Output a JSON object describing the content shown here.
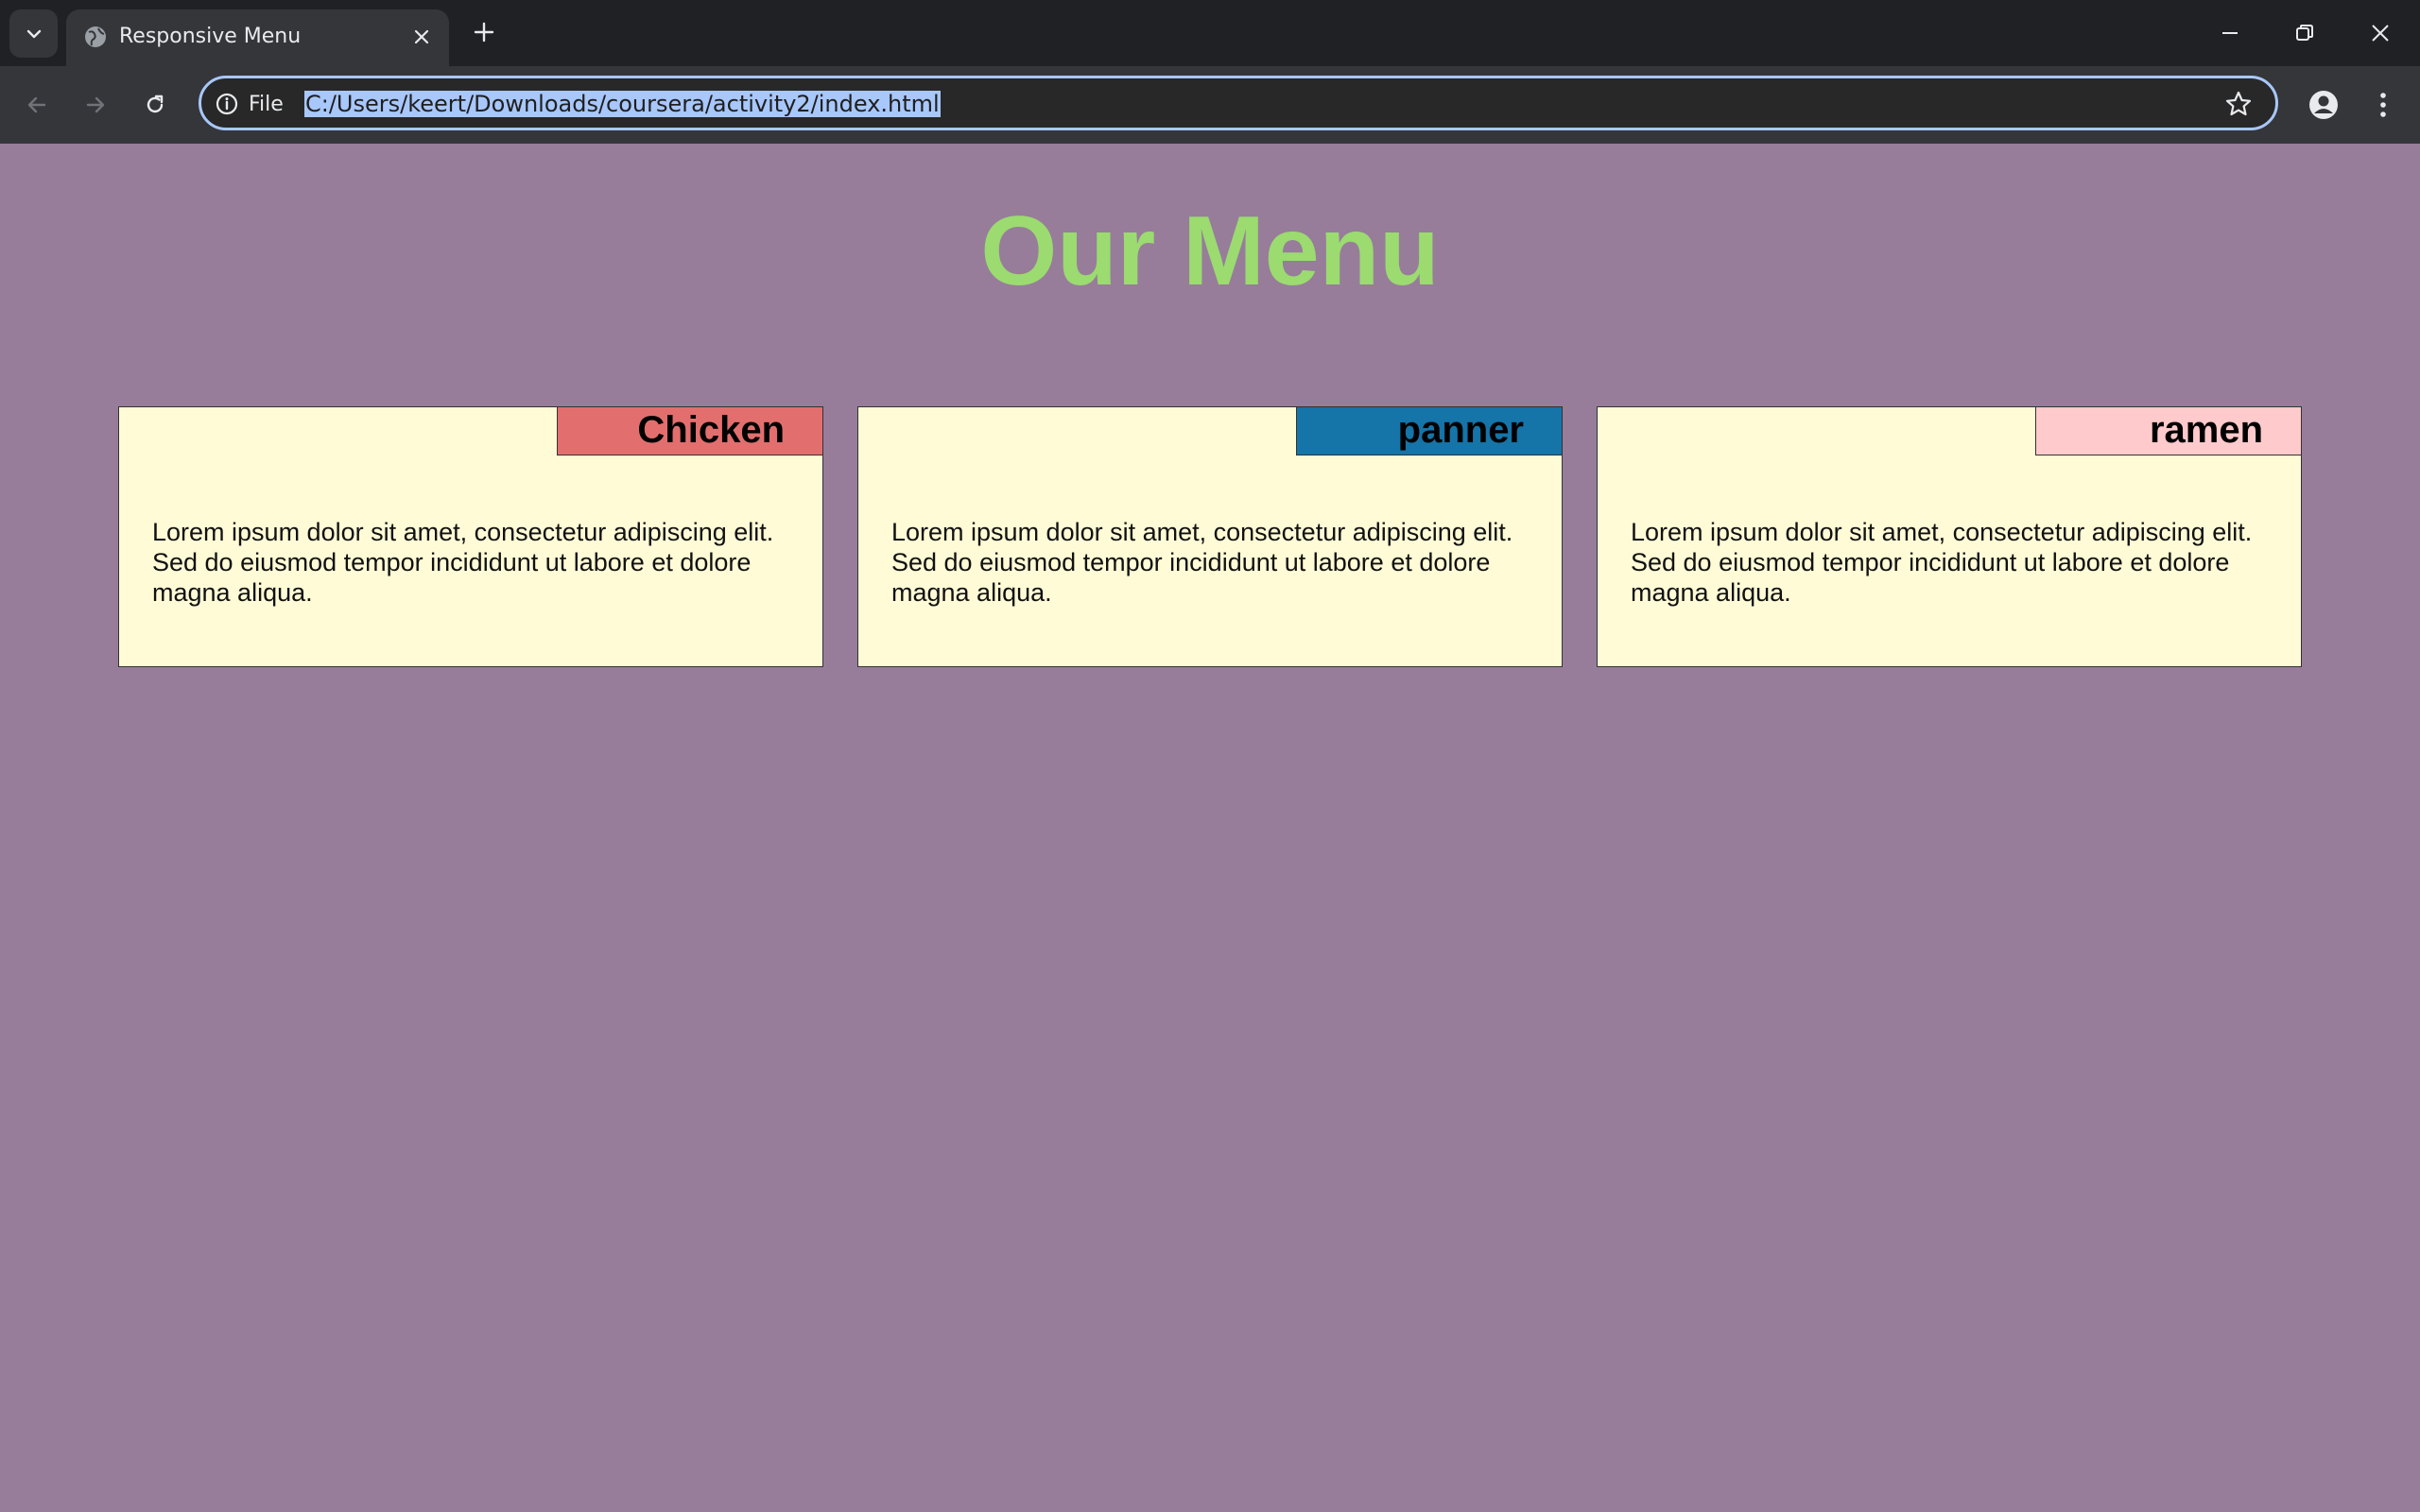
{
  "browser": {
    "tab_title": "Responsive Menu",
    "site_info_label": "File",
    "url": "C:/Users/keert/Downloads/coursera/activity2/index.html",
    "icons": {
      "tab_search": "chevron-down-icon",
      "favicon": "globe-icon",
      "tab_close": "close-icon",
      "new_tab": "plus-icon",
      "minimize": "minimize-icon",
      "restore": "restore-icon",
      "close_window": "close-icon",
      "back": "arrow-left-icon",
      "forward": "arrow-right-icon",
      "reload": "reload-icon",
      "info": "info-icon",
      "bookmark": "star-icon",
      "profile": "person-icon",
      "menu": "kebab-menu-icon"
    }
  },
  "page": {
    "title": "Our Menu",
    "background_color": "#977d9a",
    "title_color": "#9bdb70",
    "card_background": "#fffbd6",
    "cards": [
      {
        "label": "Chicken",
        "label_color": "#e26f6e",
        "text": "Lorem ipsum dolor sit amet, consectetur adipiscing elit. Sed do eiusmod tempor incididunt ut labore et dolore magna aliqua."
      },
      {
        "label": "panner",
        "label_color": "#1574a8",
        "text": "Lorem ipsum dolor sit amet, consectetur adipiscing elit. Sed do eiusmod tempor incididunt ut labore et dolore magna aliqua."
      },
      {
        "label": "ramen",
        "label_color": "#ffcacc",
        "text": "Lorem ipsum dolor sit amet, consectetur adipiscing elit. Sed do eiusmod tempor incididunt ut labore et dolore magna aliqua."
      }
    ]
  }
}
